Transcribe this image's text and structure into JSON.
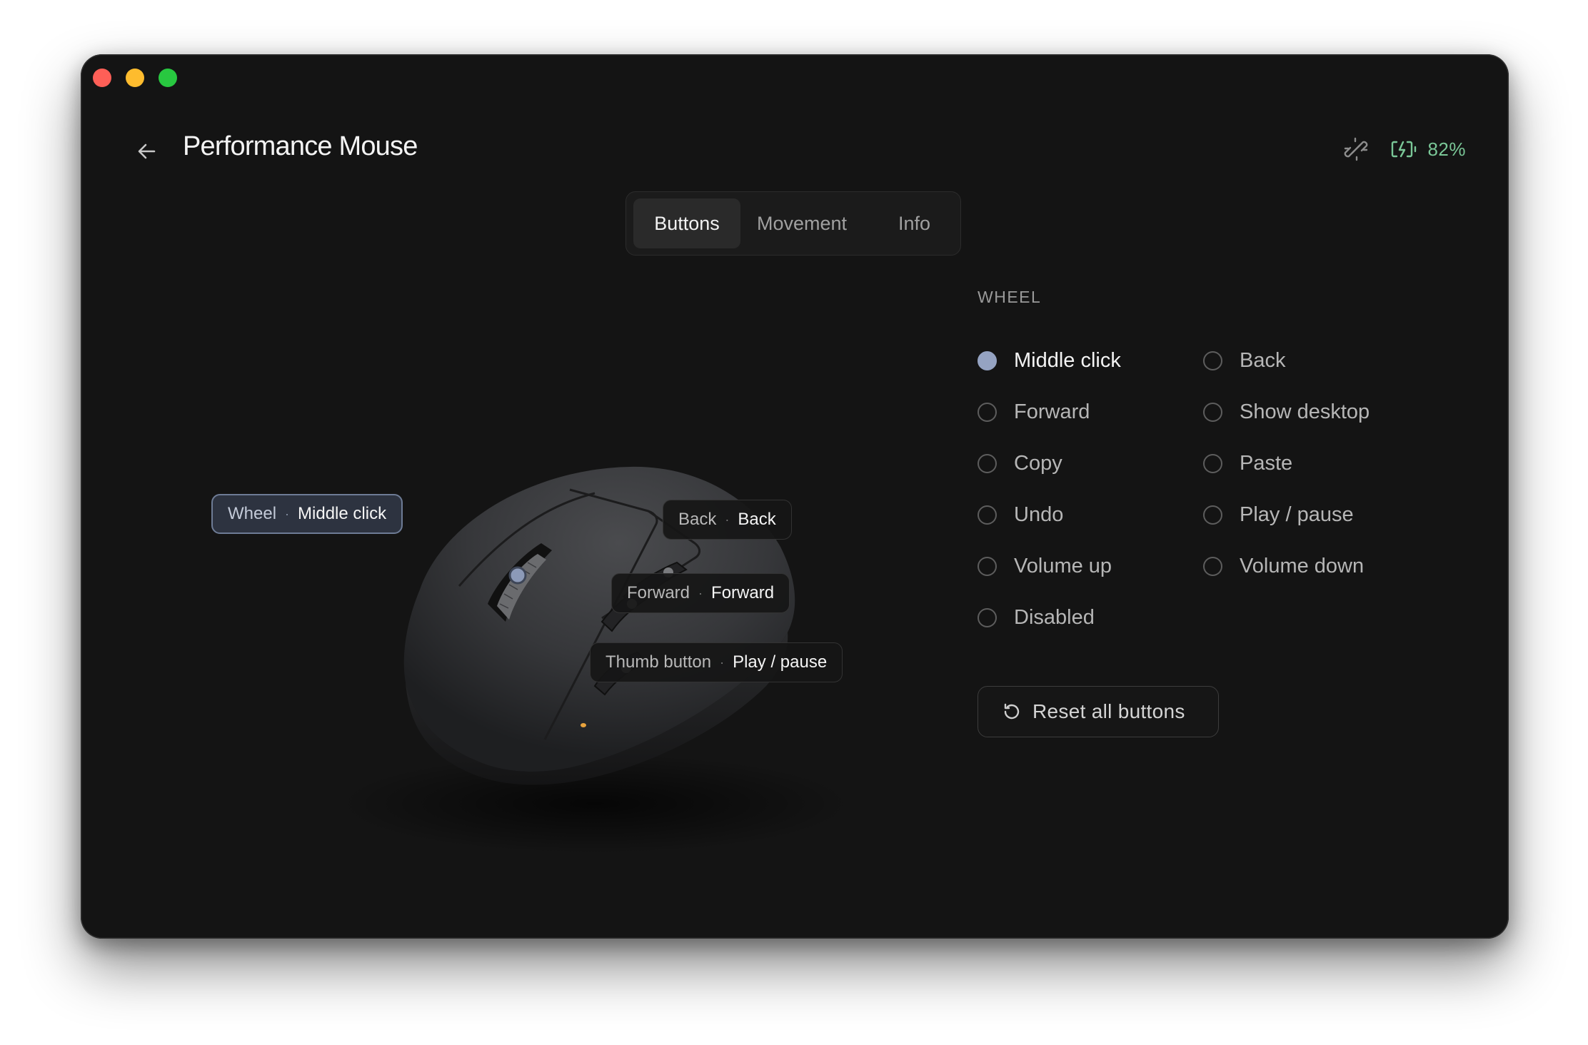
{
  "window": {
    "title": "Performance Mouse"
  },
  "status": {
    "unlink_icon": "unlink-icon",
    "battery_icon": "battery-charging-icon",
    "battery_percent": "82%",
    "battery_color": "#7ac797"
  },
  "tabs": [
    {
      "label": "Buttons",
      "active": true
    },
    {
      "label": "Movement",
      "active": false
    },
    {
      "label": "Info",
      "active": false
    }
  ],
  "callouts": {
    "wheel": {
      "key": "Wheel",
      "value": "Middle click",
      "selected": true
    },
    "back": {
      "key": "Back",
      "value": "Back"
    },
    "forward": {
      "key": "Forward",
      "value": "Forward"
    },
    "thumb": {
      "key": "Thumb button",
      "value": "Play / pause"
    },
    "separator": "·"
  },
  "panel": {
    "section_label": "WHEEL",
    "options": [
      {
        "label": "Middle click",
        "selected": true
      },
      {
        "label": "Back",
        "selected": false
      },
      {
        "label": "Forward",
        "selected": false
      },
      {
        "label": "Show desktop",
        "selected": false
      },
      {
        "label": "Copy",
        "selected": false
      },
      {
        "label": "Paste",
        "selected": false
      },
      {
        "label": "Undo",
        "selected": false
      },
      {
        "label": "Play / pause",
        "selected": false
      },
      {
        "label": "Volume up",
        "selected": false
      },
      {
        "label": "Volume down",
        "selected": false
      },
      {
        "label": "Disabled",
        "selected": false
      }
    ],
    "reset_label": "Reset all buttons",
    "reset_icon": "reset-icon"
  },
  "colors": {
    "window_bg": "#141414",
    "accent": "#95a3c2",
    "traffic_red": "#fe5f57",
    "traffic_yellow": "#febc2e",
    "traffic_green": "#28c840"
  }
}
